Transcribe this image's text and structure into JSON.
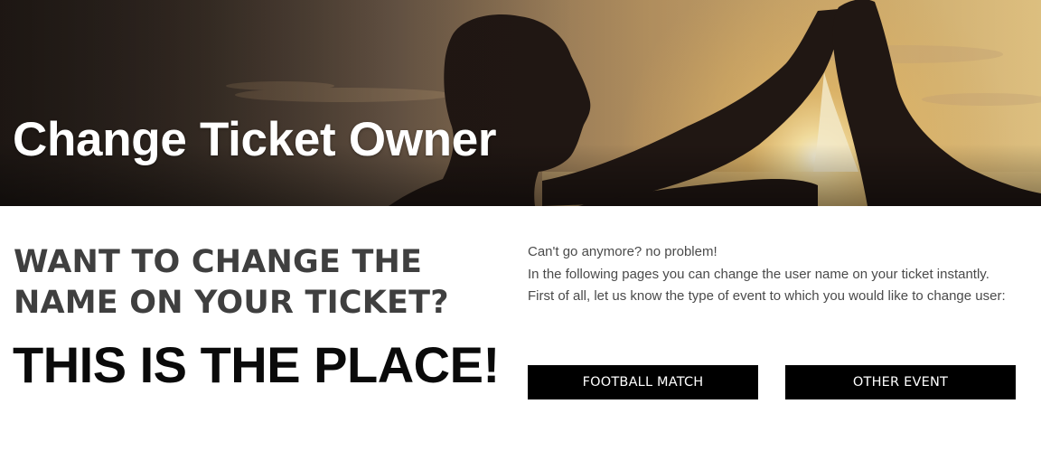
{
  "hero": {
    "title": "Change Ticket Owner",
    "image": "silhouette-high-five-at-sunset"
  },
  "main": {
    "heading_question": "WANT TO CHANGE THE NAME ON YOUR TICKET?",
    "heading_place": "THIS IS THE PLACE!",
    "intro_lines": [
      "Can't go anymore? no problem!",
      "In the following pages you can change the user name on your ticket instantly.",
      "First of all, let us know the type of event to which you would like to change user:"
    ],
    "buttons": {
      "football_label": "FOOTBALL MATCH",
      "other_label": "OTHER EVENT"
    }
  },
  "colors": {
    "button_bg": "#000000",
    "button_text": "#ffffff",
    "heading_dark": "#3f3f3f",
    "body_text": "#4a4a4a"
  }
}
